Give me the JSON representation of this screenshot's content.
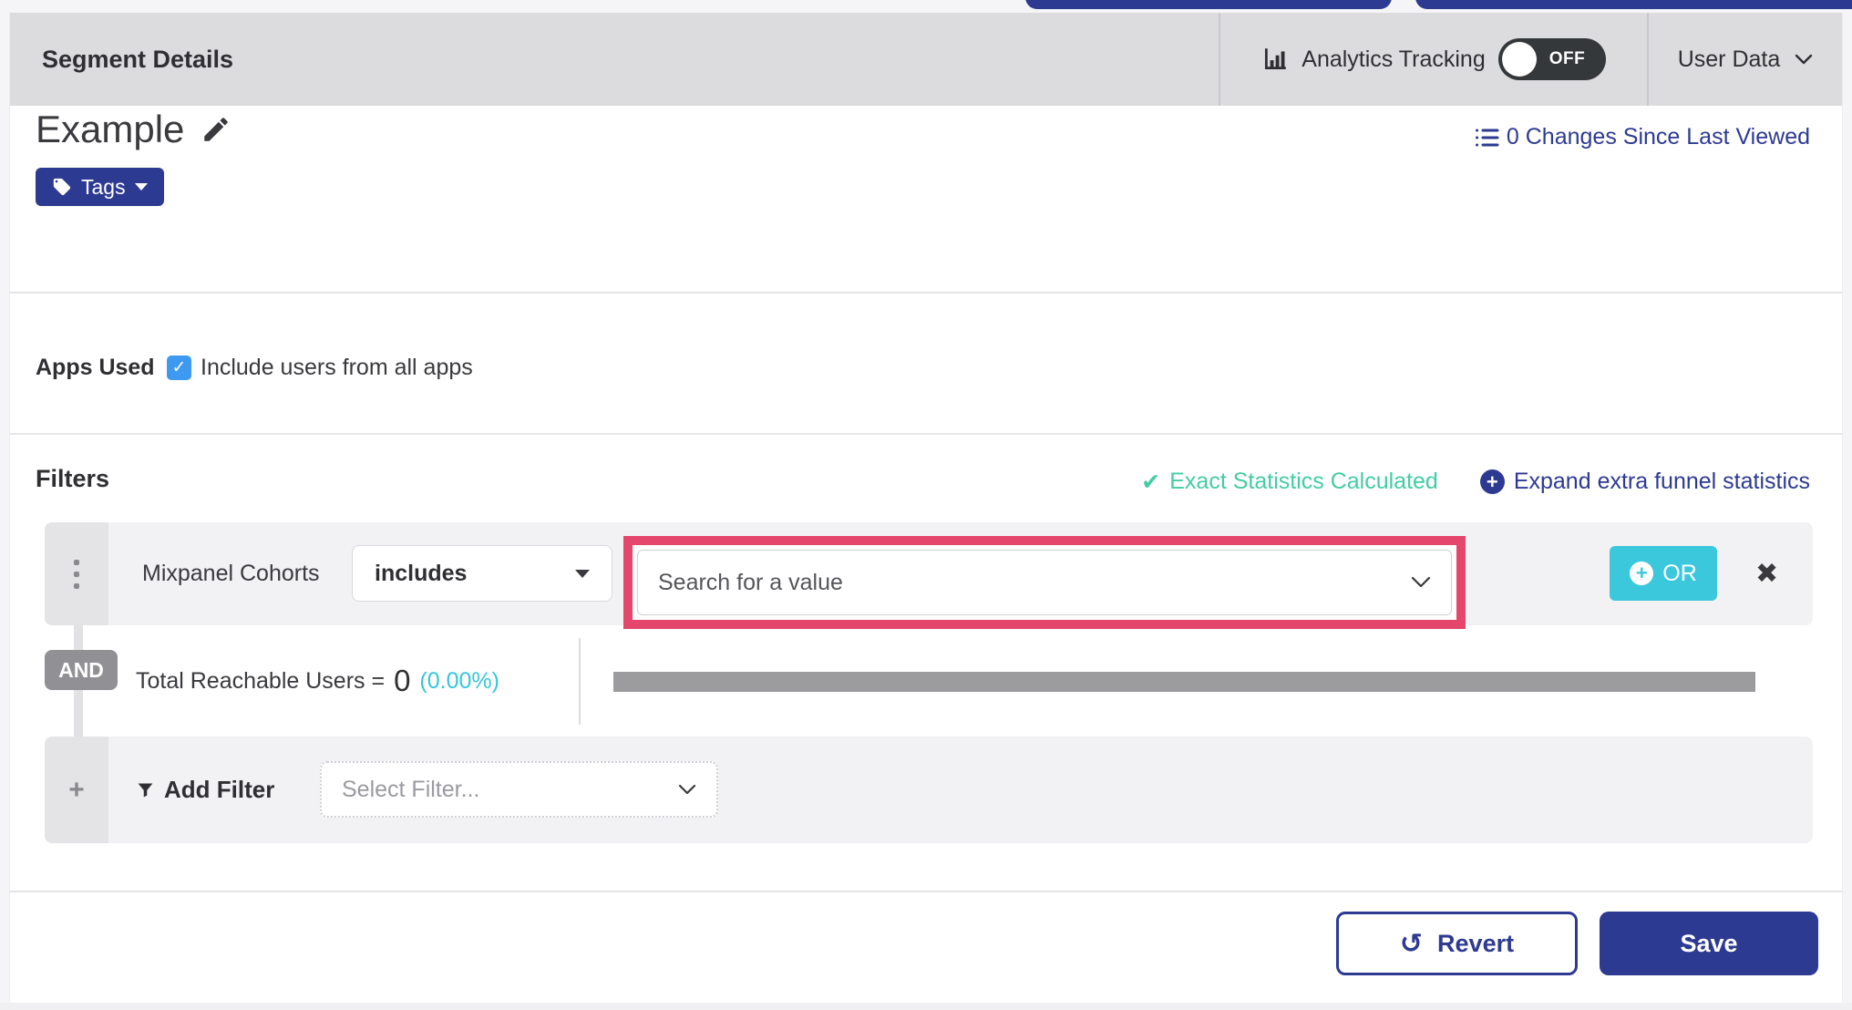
{
  "header": {
    "title": "Segment Details",
    "analytics_label": "Analytics Tracking",
    "toggle_state": "OFF",
    "user_data_label": "User Data"
  },
  "segment": {
    "name": "Example",
    "tags_label": "Tags",
    "changes_link": "0 Changes Since Last Viewed"
  },
  "apps_used": {
    "label": "Apps Used",
    "checkbox_label": "Include users from all apps",
    "checked": true,
    "check_glyph": "✓"
  },
  "filters": {
    "heading": "Filters",
    "exact_stats_check": "✔",
    "exact_stats": "Exact Statistics Calculated",
    "expand_plus": "+",
    "expand_link": "Expand extra funnel statistics",
    "filter_row": {
      "field": "Mixpanel Cohorts",
      "operator": "includes",
      "value_placeholder": "Search for a value",
      "or_plus": "+",
      "or_label": "OR",
      "close_glyph": "✖"
    },
    "and_label": "AND",
    "reachable": {
      "label": "Total Reachable Users =",
      "value": "0",
      "percent": "(0.00%)"
    },
    "add_filter": {
      "plus_glyph": "+",
      "label": "Add Filter",
      "placeholder": "Select Filter..."
    }
  },
  "footer": {
    "revert_icon": "↺",
    "revert_label": "Revert",
    "save_label": "Save"
  },
  "colors": {
    "brand_blue": "#2d3a91",
    "cyan": "#3bc8dc",
    "teal_success": "#43cda2",
    "highlight_pink": "#e5466b",
    "checkbox_blue": "#3d9af0",
    "header_gray": "#dcdcdf"
  }
}
